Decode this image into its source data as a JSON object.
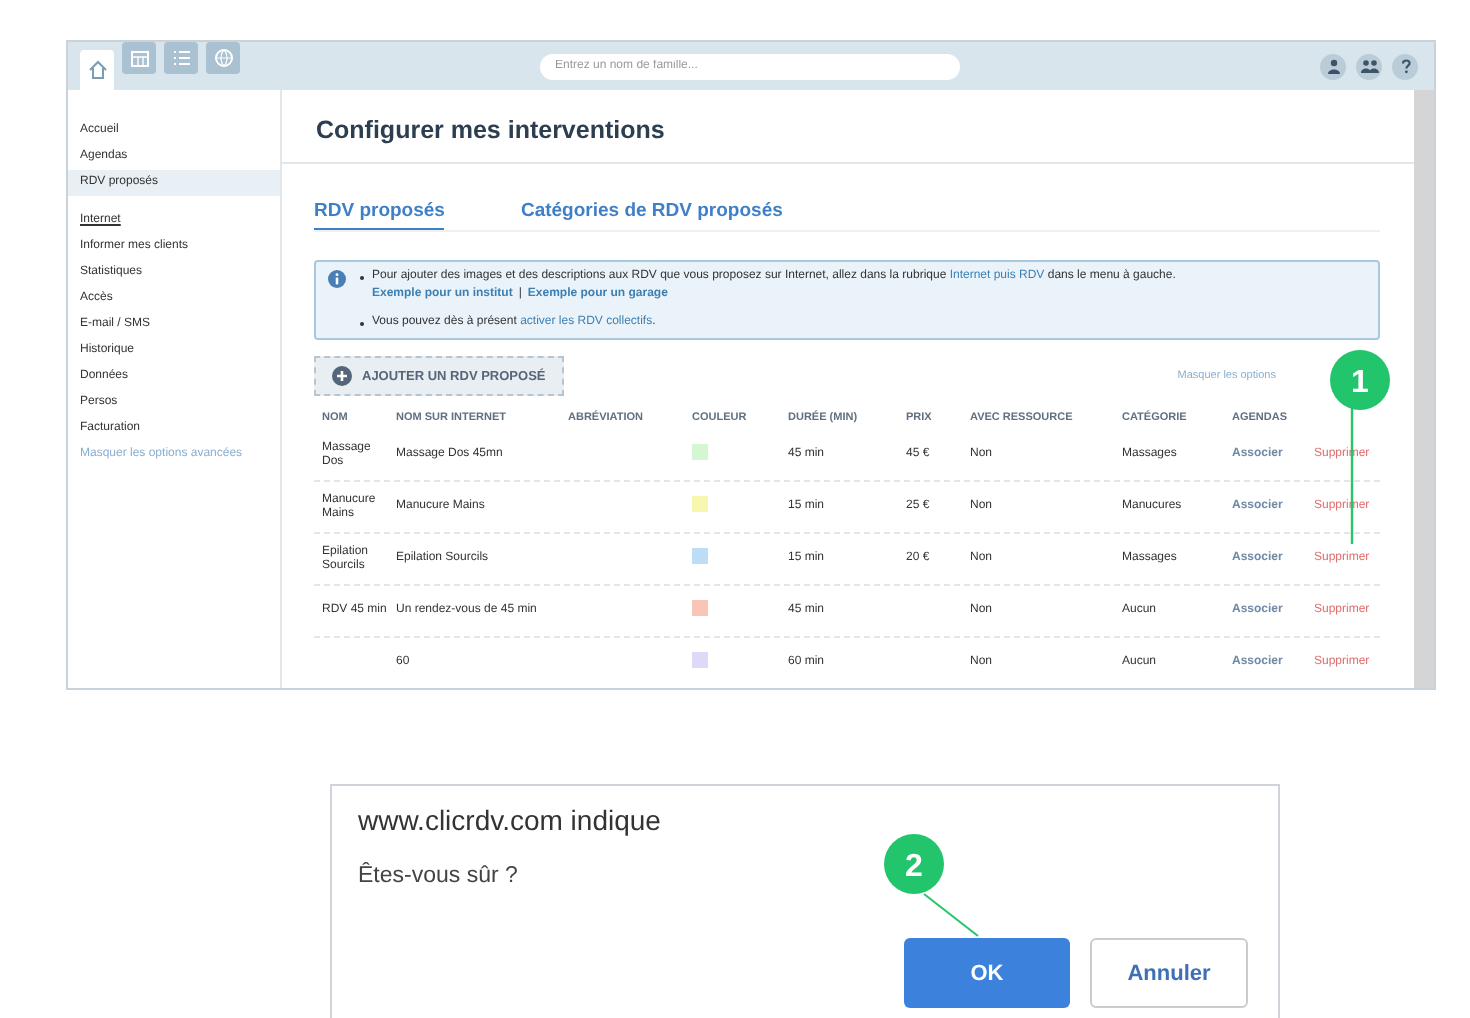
{
  "toolbar": {
    "tabs": [
      {
        "selected": true
      },
      {
        "selected": false
      },
      {
        "selected": false
      },
      {
        "selected": false
      }
    ],
    "search": {
      "placeholder": "Entrez un nom de famille..."
    }
  },
  "sidebar": {
    "items": [
      {
        "label": "Accueil",
        "selected": false
      },
      {
        "label": "Agendas",
        "selected": false
      },
      {
        "label": "RDV proposés",
        "selected": true
      }
    ],
    "section": "Internet",
    "section_items": [
      {
        "label": "Informer mes clients",
        "selected": false
      },
      {
        "label": "Statistiques",
        "selected": false
      },
      {
        "label": "Accès",
        "selected": false
      },
      {
        "label": "E-mail / SMS",
        "selected": false
      },
      {
        "label": "Historique",
        "selected": false
      },
      {
        "label": "Données",
        "selected": false
      },
      {
        "label": "Persos",
        "selected": false
      },
      {
        "label": "Facturation",
        "selected": false
      }
    ],
    "advanced_link": "Masquer les options avancées"
  },
  "page_title": "Configurer mes interventions",
  "tabs": [
    {
      "label": "RDV proposés",
      "selected": true
    },
    {
      "label": "Catégories de RDV proposés",
      "selected": false
    }
  ],
  "info": {
    "bullets": [
      {
        "before": "Pour ajouter des images et des descriptions aux RDV que vous proposez sur Internet, allez dans la rubrique ",
        "link": "Internet puis RDV",
        "after": " dans le menu à gauche.",
        "sublinks": [
          "Exemple pour un institut",
          "Exemple pour un garage"
        ],
        "separator": "|"
      },
      {
        "before": "Vous pouvez dès à présent ",
        "link": "activer les RDV collectifs",
        "after": "."
      }
    ]
  },
  "add_button": "AJOUTER UN RDV PROPOSÉ",
  "options_link": "Masquer les options",
  "table": {
    "columns": [
      "NOM",
      "NOM SUR INTERNET",
      "ABRÉVIATION",
      "COULEUR",
      "DURÉE (MIN)",
      "PRIX",
      "AVEC RESSOURCE",
      "CATÉGORIE",
      "AGENDAS"
    ],
    "rows": [
      {
        "nom": "Massage Dos",
        "nom_internet": "Massage Dos 45mn",
        "color": "#d6f5d3",
        "duree": "45 min",
        "prix": "45 €",
        "ressource": "Non",
        "categorie": "Massages",
        "agendas": "Associer",
        "action": "Supprimer"
      },
      {
        "nom": "Manucure Mains",
        "nom_internet": "Manucure Mains",
        "color": "#f8f7b0",
        "duree": "15 min",
        "prix": "25 €",
        "ressource": "Non",
        "categorie": "Manucures",
        "agendas": "Associer",
        "action": "Supprimer"
      },
      {
        "nom": "Epilation Sourcils",
        "nom_internet": "Epilation Sourcils",
        "color": "#bfdcf5",
        "duree": "15 min",
        "prix": "20 €",
        "ressource": "Non",
        "categorie": "Massages",
        "agendas": "Associer",
        "action": "Supprimer"
      },
      {
        "nom": "RDV 45 min",
        "nom_internet": "Un rendez-vous de 45 min",
        "color": "#f8c6b9",
        "duree": "45 min",
        "ressource": "Non",
        "categorie": "Aucun",
        "agendas": "Associer",
        "action": "Supprimer"
      },
      {
        "nom_internet": "60",
        "color": "#ddd9f6",
        "duree": "60 min",
        "ressource": "Non",
        "categorie": "Aucun",
        "agendas": "Associer",
        "action": "Supprimer"
      }
    ]
  },
  "dialog": {
    "title": "www.clicrdv.com indique",
    "message": "Êtes-vous sûr ?",
    "buttons": [
      {
        "label": "OK",
        "kind": "primary"
      },
      {
        "label": "Annuler",
        "kind": "secondary"
      }
    ]
  },
  "callouts": [
    "1",
    "2"
  ]
}
